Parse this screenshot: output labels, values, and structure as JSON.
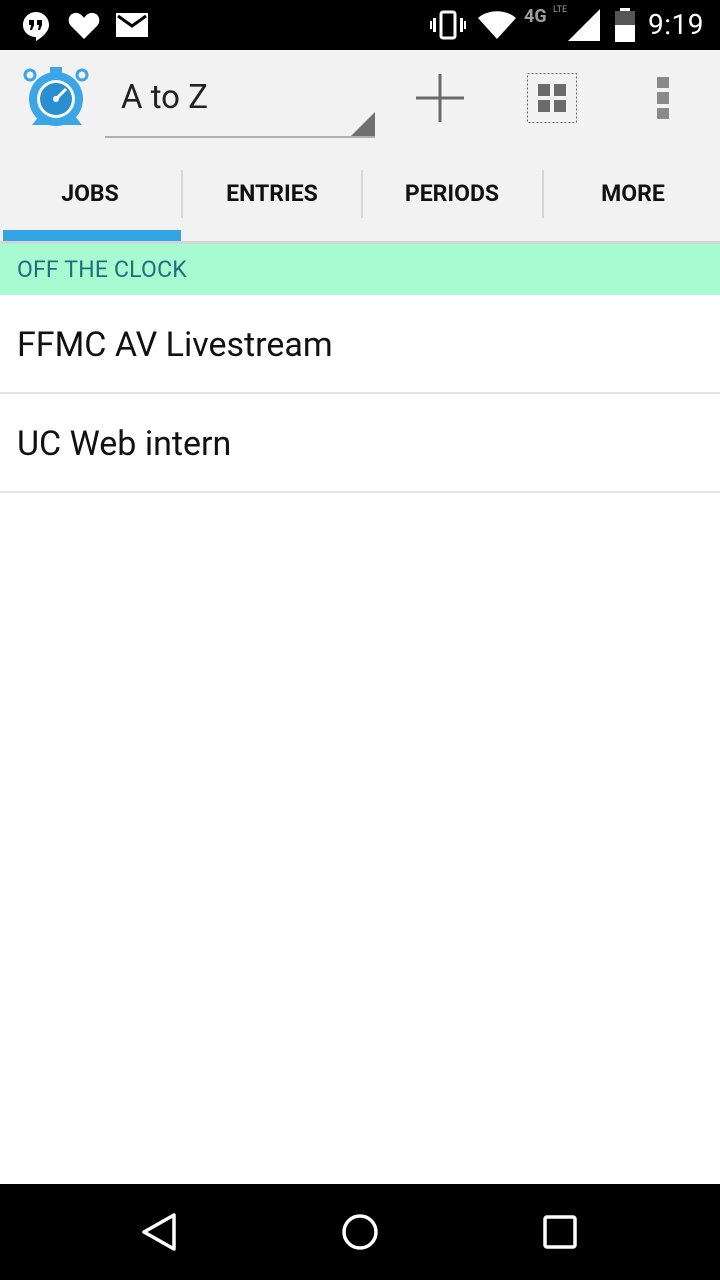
{
  "status_bar": {
    "time": "9:19",
    "network": "4G",
    "network_sub": "LTE",
    "icons": [
      "hangouts-icon",
      "heart-icon",
      "mail-icon",
      "vibrate-icon",
      "wifi-icon",
      "signal-icon",
      "battery-icon"
    ]
  },
  "action_bar": {
    "sort_selected": "A to Z",
    "add_icon": "plus-icon",
    "grid_icon": "grid-icon",
    "overflow_icon": "overflow-menu-icon"
  },
  "tabs": [
    {
      "label": "JOBS",
      "selected": true
    },
    {
      "label": "ENTRIES",
      "selected": false
    },
    {
      "label": "PERIODS",
      "selected": false
    },
    {
      "label": "MORE",
      "selected": false
    }
  ],
  "section": {
    "label": "OFF THE CLOCK"
  },
  "jobs": [
    {
      "name": "FFMC AV Livestream"
    },
    {
      "name": "UC Web intern"
    }
  ],
  "nav": {
    "back": "back-icon",
    "home": "home-icon",
    "recents": "recents-icon"
  },
  "colors": {
    "accent": "#33a5e5",
    "section_bg": "#a6fbd0",
    "section_text": "#1e6f7a",
    "bar_bg": "#f2f2f2"
  }
}
